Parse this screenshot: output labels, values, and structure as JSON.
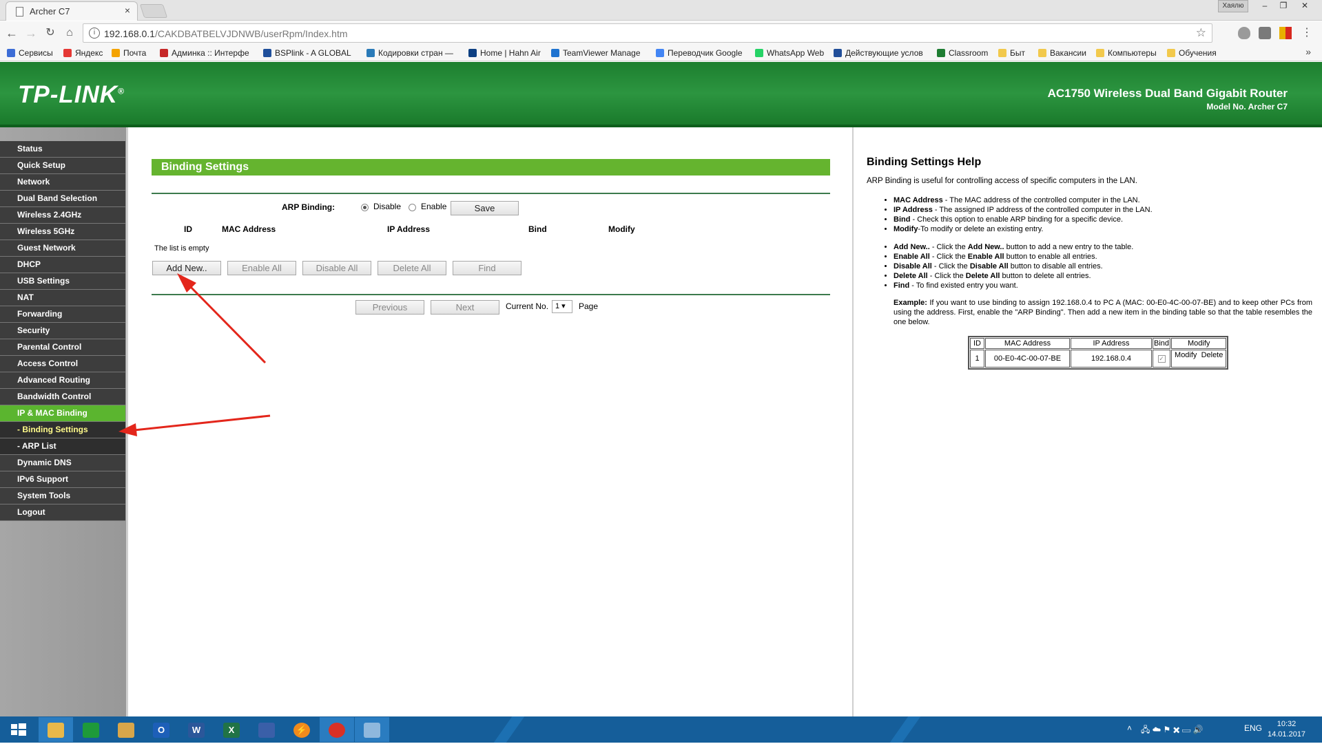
{
  "browser": {
    "tab_title": "Archer C7",
    "tab_close": "×",
    "url_host": "192.168.0.1",
    "url_rest": "/CAKDBATBELVJDNWB/userRpm/Index.htm",
    "window_user": "Хаялю",
    "bookmarks": [
      {
        "label": "Сервисы",
        "color": "#3d6dd6"
      },
      {
        "label": "Яндекс",
        "color": "#e53935"
      },
      {
        "label": "Почта",
        "color": "#f4a300"
      },
      {
        "label": "Админка :: Интерфе",
        "color": "#c62828"
      },
      {
        "label": "BSPlink - A GLOBAL",
        "color": "#1f4f9b"
      },
      {
        "label": "Кодировки стран —",
        "color": "#2a7ab8"
      },
      {
        "label": "Home | Hahn Air",
        "color": "#0d3f82"
      },
      {
        "label": "TeamViewer Manage",
        "color": "#1e73d0"
      },
      {
        "label": "Переводчик Google",
        "color": "#4285f4"
      },
      {
        "label": "WhatsApp Web",
        "color": "#25d366"
      },
      {
        "label": "Действующие услов",
        "color": "#214e99"
      },
      {
        "label": "Classroom",
        "color": "#1e7d32"
      },
      {
        "label": "Быт",
        "color": "#f2c94c"
      },
      {
        "label": "Вакансии",
        "color": "#f2c94c"
      },
      {
        "label": "Компьютеры",
        "color": "#f2c94c"
      },
      {
        "label": "Обучения",
        "color": "#f2c94c"
      }
    ],
    "bookmarks_more": "»"
  },
  "router": {
    "logo": "TP-LINK",
    "logo_mark": "®",
    "title": "AC1750 Wireless Dual Band Gigabit Router",
    "model": "Model No. Archer C7"
  },
  "menu": [
    {
      "label": "Status"
    },
    {
      "label": "Quick Setup"
    },
    {
      "label": "Network"
    },
    {
      "label": "Dual Band Selection"
    },
    {
      "label": "Wireless 2.4GHz"
    },
    {
      "label": "Wireless 5GHz"
    },
    {
      "label": "Guest Network"
    },
    {
      "label": "DHCP"
    },
    {
      "label": "USB Settings"
    },
    {
      "label": "NAT"
    },
    {
      "label": "Forwarding"
    },
    {
      "label": "Security"
    },
    {
      "label": "Parental Control"
    },
    {
      "label": "Access Control"
    },
    {
      "label": "Advanced Routing"
    },
    {
      "label": "Bandwidth Control"
    },
    {
      "label": "IP & MAC Binding"
    },
    {
      "label": "- Binding Settings"
    },
    {
      "label": "- ARP List"
    },
    {
      "label": "Dynamic DNS"
    },
    {
      "label": "IPv6 Support"
    },
    {
      "label": "System Tools"
    },
    {
      "label": "Logout"
    }
  ],
  "main": {
    "section_title": "Binding Settings",
    "arp_label": "ARP Binding:",
    "arp_disable": "Disable",
    "arp_enable": "Enable",
    "arp_selected": "Disable",
    "save": "Save",
    "columns": [
      "ID",
      "MAC Address",
      "IP Address",
      "Bind",
      "Modify"
    ],
    "empty": "The list is empty",
    "buttons": {
      "add_new": "Add New..",
      "enable_all": "Enable All",
      "disable_all": "Disable All",
      "delete_all": "Delete All",
      "find": "Find"
    },
    "pager": {
      "previous": "Previous",
      "next": "Next",
      "current_label": "Current No.",
      "current_value": "1",
      "page_label": "Page"
    }
  },
  "help": {
    "title": "Binding Settings Help",
    "intro": "ARP Binding is useful for controlling access of specific computers in the LAN.",
    "fields": [
      {
        "term": "MAC Address",
        "text": " - The MAC address of the controlled computer in the LAN."
      },
      {
        "term": "IP Address",
        "text": " - The assigned IP address of the controlled computer in the LAN."
      },
      {
        "term": "Bind",
        "text": " - Check this option to enable ARP binding for a specific device."
      },
      {
        "term": "Modify",
        "text": "-To modify or delete an existing entry."
      }
    ],
    "actions": [
      {
        "term": "Add New..",
        "pre": " - Click the ",
        "bold": "Add New..",
        "post": " button to add a new entry to the table."
      },
      {
        "term": "Enable All",
        "pre": " - Click the ",
        "bold": "Enable All",
        "post": " button to enable all entries."
      },
      {
        "term": "Disable All",
        "pre": " - Click the ",
        "bold": "Disable All",
        "post": " button to disable all entries."
      },
      {
        "term": "Delete All",
        "pre": " - Click the ",
        "bold": "Delete All",
        "post": " button to delete all entries."
      },
      {
        "term": "Find",
        "pre": " - To find existed entry you want.",
        "bold": "",
        "post": ""
      }
    ],
    "example_label": "Example:",
    "example_text": " If you want to use binding to assign 192.168.0.4 to PC A (MAC: 00-E0-4C-00-07-BE) and to keep other PCs from using the address. First, enable the \"ARP Binding\". Then add a new item in the binding table so that the table resembles the one below.",
    "table": {
      "headers": [
        "ID",
        "MAC Address",
        "IP Address",
        "Bind",
        "Modify"
      ],
      "row": {
        "id": "1",
        "mac": "00-E0-4C-00-07-BE",
        "ip": "192.168.0.4",
        "modify": "Modify",
        "delete": "Delete"
      }
    }
  },
  "taskbar": {
    "apps": [
      {
        "name": "file-explorer",
        "glyph": "",
        "color": "#e8b84a"
      },
      {
        "name": "store",
        "glyph": "",
        "color": "#1e9a3a"
      },
      {
        "name": "tools",
        "glyph": "",
        "color": "#d8a64a"
      },
      {
        "name": "outlook",
        "glyph": "O",
        "color": "#1d5fb8"
      },
      {
        "name": "word",
        "glyph": "W",
        "color": "#2b579a"
      },
      {
        "name": "excel",
        "glyph": "X",
        "color": "#217346"
      },
      {
        "name": "network-app",
        "glyph": "",
        "color": "#3a5fa8"
      },
      {
        "name": "lightning-app",
        "glyph": "⚡",
        "color": "#f08a1c"
      },
      {
        "name": "chrome",
        "glyph": "",
        "color": "#d93025"
      },
      {
        "name": "remote-desktop",
        "glyph": "",
        "color": "#8fb8dd"
      }
    ],
    "lang": "ENG",
    "time": "10:32",
    "date": "14.01.2017"
  }
}
